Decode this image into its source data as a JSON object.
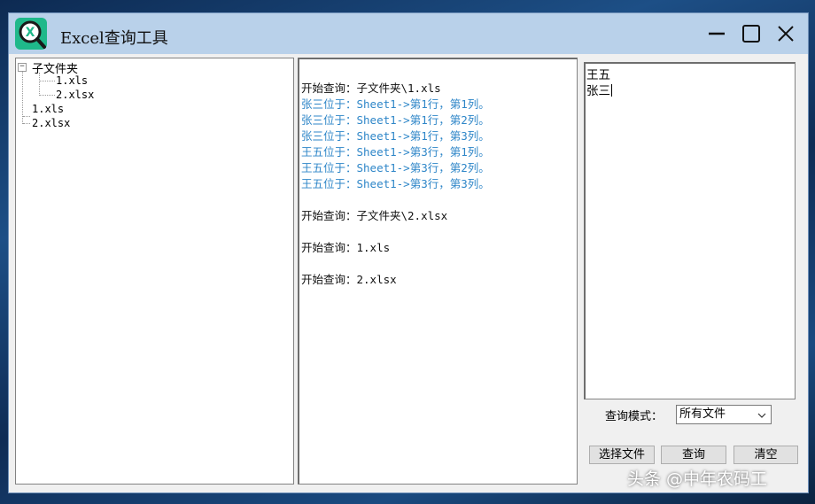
{
  "window": {
    "title": "Excel查询工具",
    "accent": "#1fb88a",
    "titlebar_color": "#b9d1ea"
  },
  "file_tree": {
    "folder": "子文件夹",
    "folder_children": [
      "1.xls",
      "2.xlsx"
    ],
    "root_files": [
      "1.xls",
      "2.xlsx"
    ],
    "toggle_glyph": "−"
  },
  "log": {
    "heading_color": "#111111",
    "hit_color": "#2e86c8",
    "lines": [
      {
        "type": "heading",
        "text": "开始查询：子文件夹\\1.xls"
      },
      {
        "type": "hit",
        "text": "张三位于：Sheet1->第1行，第1列。"
      },
      {
        "type": "hit",
        "text": "张三位于：Sheet1->第1行，第2列。"
      },
      {
        "type": "hit",
        "text": "张三位于：Sheet1->第1行，第3列。"
      },
      {
        "type": "hit",
        "text": "王五位于：Sheet1->第3行，第1列。"
      },
      {
        "type": "hit",
        "text": "王五位于：Sheet1->第3行，第2列。"
      },
      {
        "type": "hit",
        "text": "王五位于：Sheet1->第3行，第3列。"
      },
      {
        "type": "heading",
        "text": "开始查询：子文件夹\\2.xlsx"
      },
      {
        "type": "heading",
        "text": "开始查询：1.xls"
      },
      {
        "type": "heading",
        "text": "开始查询：2.xlsx"
      }
    ]
  },
  "search_names": [
    "王五",
    "张三"
  ],
  "query_mode": {
    "label": "查询模式：",
    "selected": "所有文件"
  },
  "buttons": {
    "select_file": "选择文件",
    "query": "查询",
    "clear": "清空"
  },
  "watermark": "头条 @中年农码工"
}
